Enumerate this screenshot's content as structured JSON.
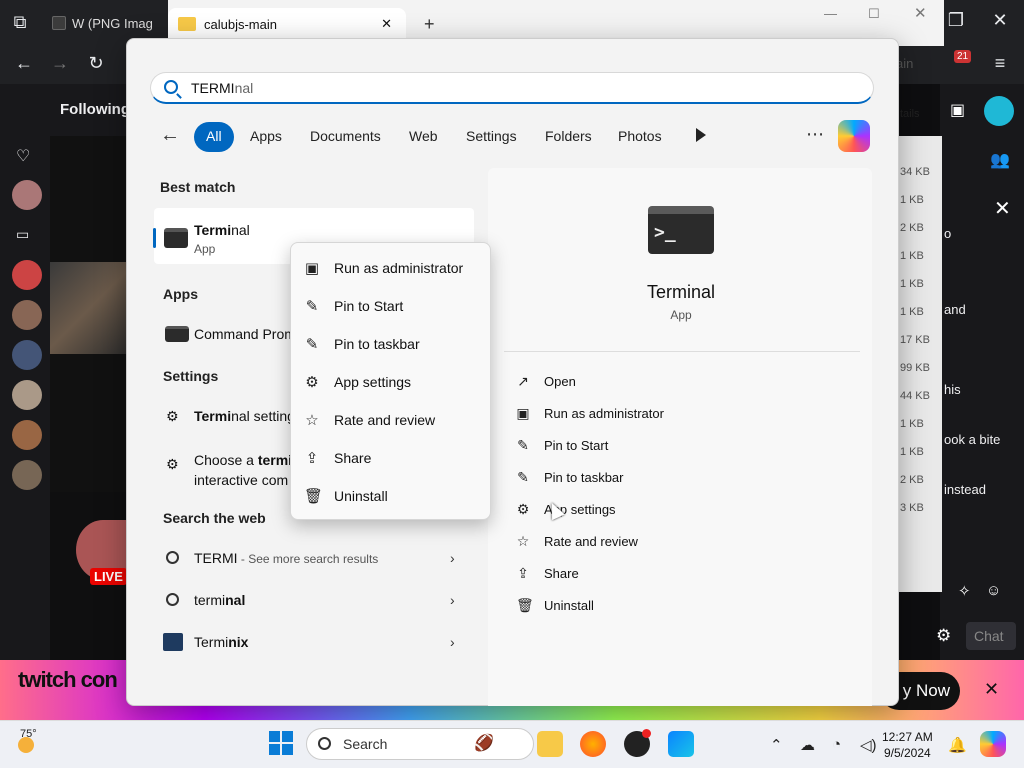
{
  "browser": {
    "bg_tab_label": "W (PNG Imag",
    "notif_count": "21",
    "following_label": "Following"
  },
  "explorer": {
    "tab_title": "calubjs-main",
    "partial_text_1": "ain",
    "partial_text_2": "tails",
    "file_sizes": [
      "34 KB",
      "1 KB",
      "2 KB",
      "1 KB",
      "1 KB",
      "1 KB",
      "17 KB",
      "99 KB",
      "44 KB",
      "1 KB",
      "1 KB",
      "2 KB",
      "3 KB"
    ]
  },
  "twitch": {
    "live_label": "LIVE",
    "chat_lines": [
      "o",
      "and",
      "his",
      "ook a bite",
      "instead"
    ],
    "chat_button": "Chat",
    "banner_logo": "twitch con",
    "banner_cta": "y Now"
  },
  "search": {
    "query_typed": "TERMI",
    "query_hint": "nal",
    "filters": [
      "All",
      "Apps",
      "Documents",
      "Web",
      "Settings",
      "Folders",
      "Photos"
    ],
    "active_filter": "All",
    "best_match_header": "Best match",
    "best_match": {
      "name_bold": "Termi",
      "name_rest": "nal",
      "type": "App"
    },
    "apps_header": "Apps",
    "apps": [
      {
        "label": "Command Prom"
      }
    ],
    "settings_header": "Settings",
    "settings": [
      {
        "bold": "Termi",
        "rest": "nal setting"
      },
      {
        "line1_pre": "Choose a ",
        "line1_bold": "termi",
        "line2": "interactive com"
      }
    ],
    "web_header": "Search the web",
    "web": [
      {
        "label": "TERMI",
        "sub": " - See more search results"
      },
      {
        "label_pre": "termi",
        "label_bold": "nal"
      },
      {
        "label_pre": "Termi",
        "label_bold": "nix"
      }
    ]
  },
  "detail": {
    "name": "Terminal",
    "type": "App",
    "actions": [
      "Open",
      "Run as administrator",
      "Pin to Start",
      "Pin to taskbar",
      "App settings",
      "Rate and review",
      "Share",
      "Uninstall"
    ]
  },
  "context_menu": {
    "items": [
      "Run as administrator",
      "Pin to Start",
      "Pin to taskbar",
      "App settings",
      "Rate and review",
      "Share",
      "Uninstall"
    ]
  },
  "taskbar": {
    "search_label": "Search",
    "time": "12:27 AM",
    "date": "9/5/2024",
    "weather": "75°"
  },
  "colors": {
    "accent": "#0067c0",
    "twitch": "#9146ff",
    "live": "#eb0400"
  }
}
